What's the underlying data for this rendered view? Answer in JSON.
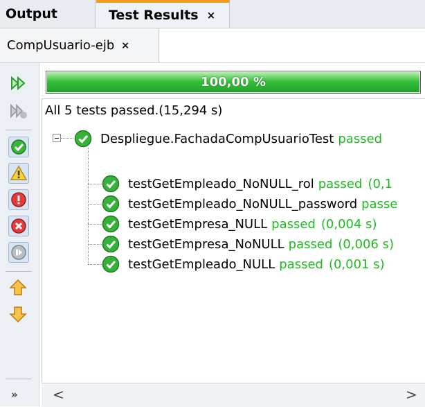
{
  "tabs": [
    {
      "label": "Output"
    },
    {
      "label": "Test Results",
      "close": "×"
    }
  ],
  "subtab": {
    "label": "CompUsuario-ejb",
    "close": "×"
  },
  "progress": {
    "label": "100,00 %",
    "percent": 100,
    "color": "#2fb834"
  },
  "summary": "All 5 tests passed.(15,294 s)",
  "suite": {
    "name": "Despliegue.FachadaCompUsuarioTest",
    "status": "passed"
  },
  "tests": [
    {
      "name": "testGetEmpleado_NoNULL_rol",
      "status": "passed",
      "time": "(0,1"
    },
    {
      "name": "testGetEmpleado_NoNULL_password",
      "status": "passe",
      "time": ""
    },
    {
      "name": "testGetEmpresa_NULL",
      "status": "passed",
      "time": "(0,004 s)"
    },
    {
      "name": "testGetEmpresa_NoNULL",
      "status": "passed",
      "time": "(0,006 s)"
    },
    {
      "name": "testGetEmpleado_NULL",
      "status": "passed",
      "time": "(0,001 s)"
    }
  ],
  "toolbar": {
    "more": "»",
    "icons": [
      "rerun-icon",
      "rerun-failed-icon",
      "show-passed-icon",
      "show-warning-icon",
      "show-error-icon",
      "show-failure-icon",
      "show-skipped-icon",
      "previous-failure-icon",
      "next-failure-icon"
    ]
  },
  "scroll": {
    "left": "<",
    "right": ">"
  },
  "colors": {
    "accent": "#f39c1b",
    "passed": "#1dbb1d",
    "progress": "#2fb834"
  }
}
